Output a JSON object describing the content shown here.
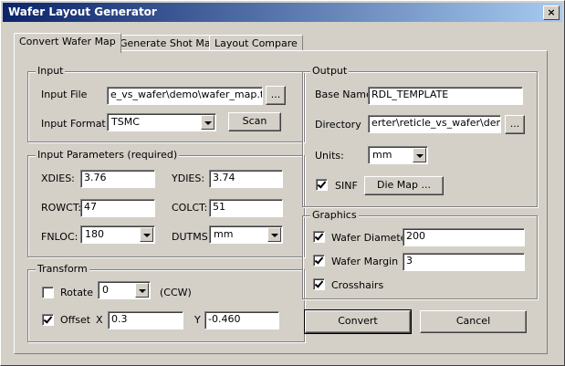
{
  "window": {
    "title": "Wafer Layout Generator",
    "close_glyph": "×"
  },
  "tabs": [
    "Convert Wafer Map",
    "Generate Shot Map",
    "Layout Compare"
  ],
  "input": {
    "legend": "Input",
    "file_label": "Input File",
    "file_value": "e_vs_wafer\\demo\\wafer_map.txt",
    "browse_label": "...",
    "format_label": "Input Format",
    "format_value": "TSMC",
    "scan_label": "Scan"
  },
  "params": {
    "legend": "Input Parameters (required)",
    "xdies_label": "XDIES:",
    "xdies_value": "3.76",
    "ydies_label": "YDIES:",
    "ydies_value": "3.74",
    "rowct_label": "ROWCT:",
    "rowct_value": "47",
    "colct_label": "COLCT:",
    "colct_value": "51",
    "fnloc_label": "FNLOC:",
    "fnloc_value": "180",
    "dutms_label": "DUTMS:",
    "dutms_value": "mm"
  },
  "transform": {
    "legend": "Transform",
    "rotate_label": "Rotate",
    "rotate_checked": false,
    "rotate_value": "0",
    "rotate_unit": "(CCW)",
    "offset_label": "Offset",
    "offset_checked": true,
    "x_label": "X",
    "x_value": "0.3",
    "y_label": "Y",
    "y_value": "-0.460"
  },
  "output": {
    "legend": "Output",
    "basename_label": "Base Name",
    "basename_value": "RDL_TEMPLATE",
    "directory_label": "Directory",
    "directory_value": "erter\\reticle_vs_wafer\\demo",
    "browse_label": "...",
    "units_label": "Units:",
    "units_value": "mm",
    "sinf_label": "SINF",
    "sinf_checked": true,
    "diemap_label": "Die Map ..."
  },
  "graphics": {
    "legend": "Graphics",
    "diameter_label": "Wafer Diameter",
    "diameter_checked": true,
    "diameter_value": "200",
    "margin_label": "Wafer Margin",
    "margin_checked": true,
    "margin_value": "3",
    "crosshairs_label": "Crosshairs",
    "crosshairs_checked": true
  },
  "actions": {
    "convert_label": "Convert",
    "cancel_label": "Cancel"
  }
}
